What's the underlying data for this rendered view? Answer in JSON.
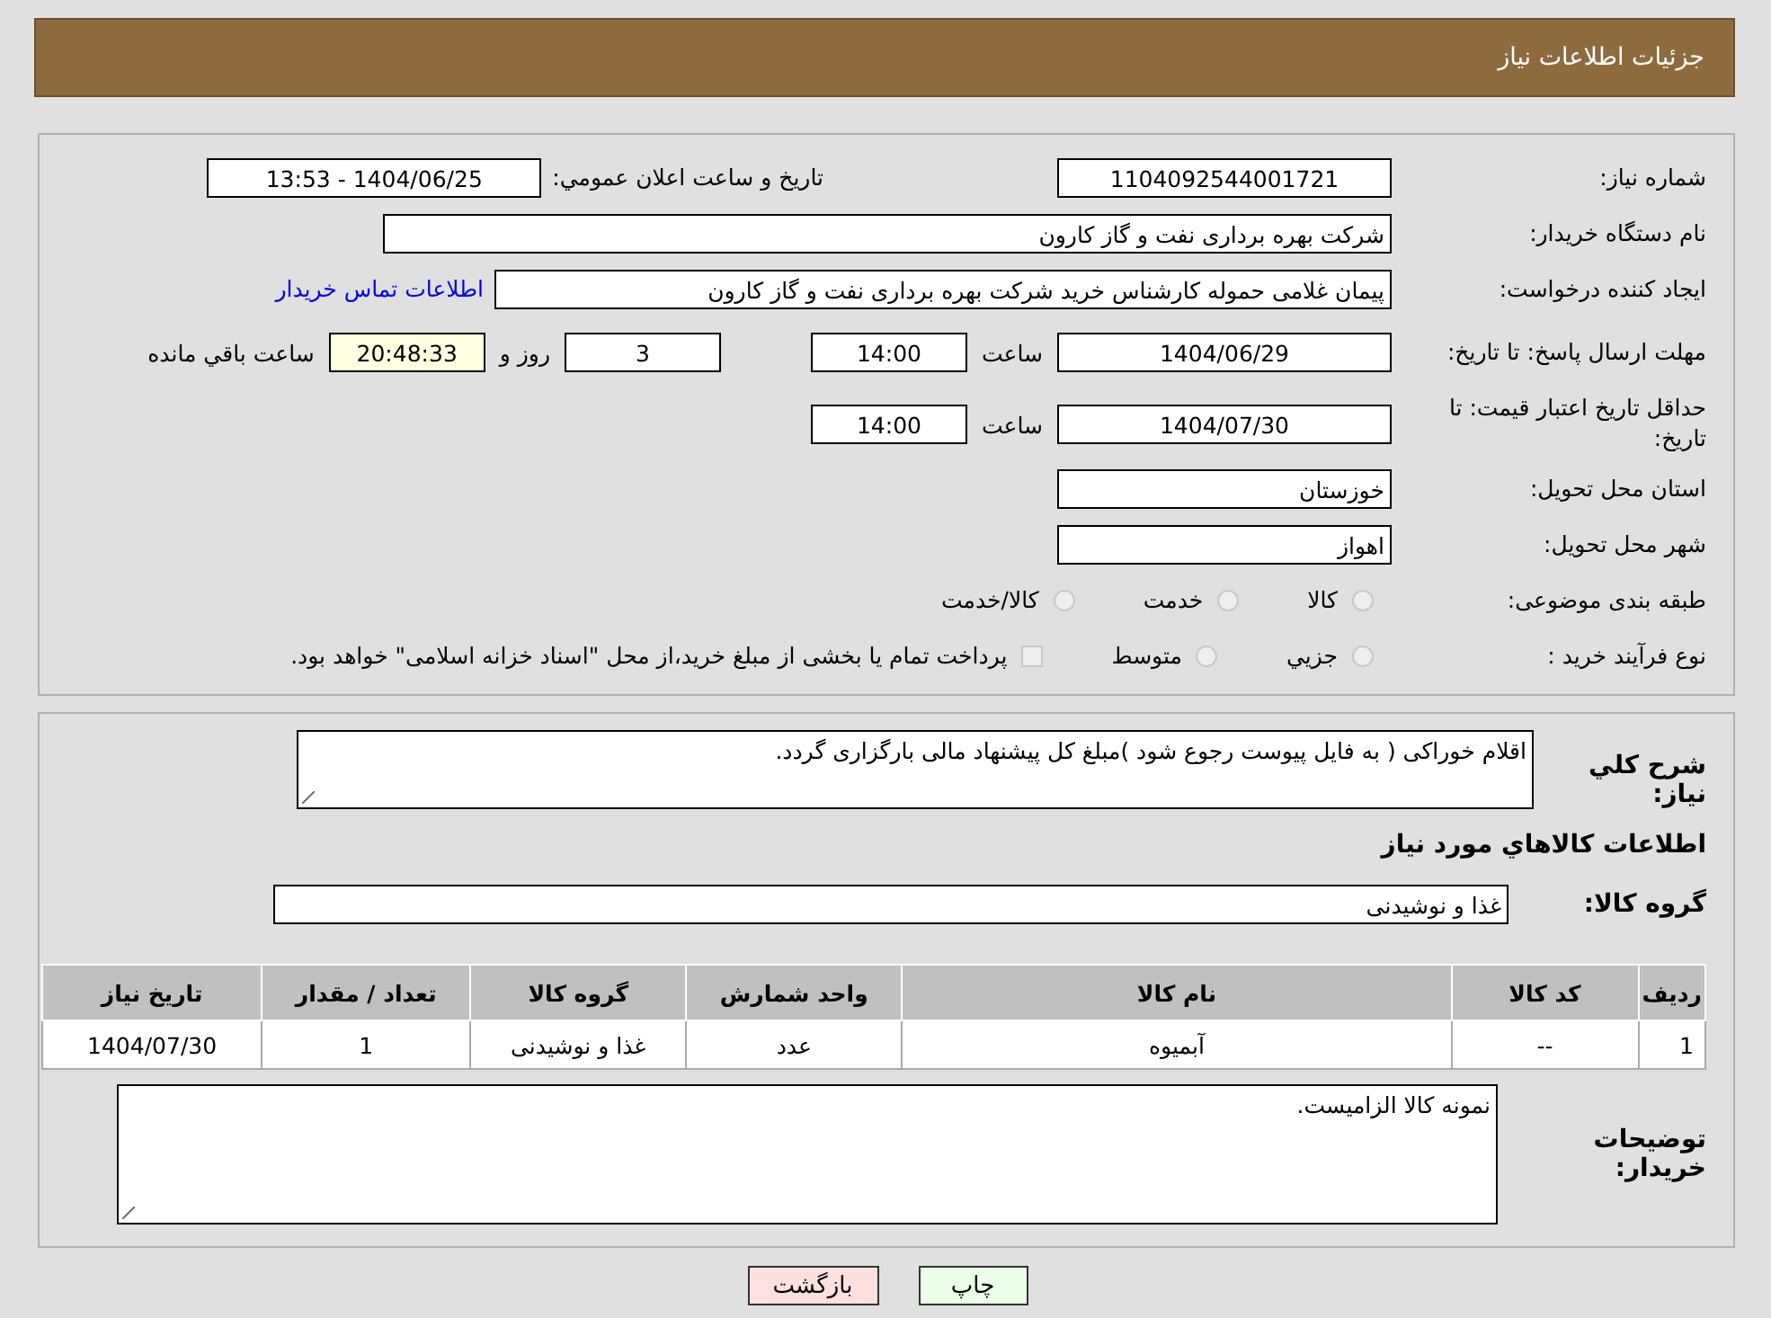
{
  "header": {
    "title": "جزئیات اطلاعات نیاز"
  },
  "need_number": {
    "label": "شماره نیاز:",
    "value": "1104092544001721"
  },
  "announce": {
    "label": "تاریخ و ساعت اعلان عمومي:",
    "value": "1404/06/25 - 13:53"
  },
  "buyer_org": {
    "label": "نام دستگاه خريدار:",
    "value": "شرکت بهره برداری نفت و گاز کارون"
  },
  "requester": {
    "label": "ايجاد کننده درخواست:",
    "value": "پیمان غلامی حموله کارشناس خرید شرکت بهره برداری نفت و گاز کارون",
    "link": "اطلاعات تماس خریدار"
  },
  "response_deadline": {
    "label": "مهلت ارسال پاسخ: تا تاریخ:",
    "date": "1404/06/29",
    "time_label": "ساعت",
    "time": "14:00",
    "days": "3",
    "days_label": "روز و",
    "remaining": "20:48:33",
    "remaining_label": "ساعت باقي مانده"
  },
  "price_validity": {
    "label": "حداقل تاریخ اعتبار قیمت: تا تاریخ:",
    "date": "1404/07/30",
    "time_label": "ساعت",
    "time": "14:00"
  },
  "province": {
    "label": "استان محل تحويل:",
    "value": "خوزستان"
  },
  "city": {
    "label": "شهر محل تحويل:",
    "value": "اهواز"
  },
  "category": {
    "label": "طبقه بندی موضوعی:",
    "options": [
      {
        "label": "کالا",
        "selected": false
      },
      {
        "label": "خدمت",
        "selected": false
      },
      {
        "label": "کالا/خدمت",
        "selected": false
      }
    ]
  },
  "purchase_type": {
    "label": "نوع فرآیند خرید :",
    "options": [
      {
        "label": "جزيي",
        "selected": false
      },
      {
        "label": "متوسط",
        "selected": false
      }
    ],
    "payment_note": {
      "text": "پرداخت تمام یا بخشی از مبلغ خرید،از محل \"اسناد خزانه اسلامی\" خواهد بود.",
      "checked": false
    }
  },
  "description": {
    "label": "شرح کلي نياز:",
    "value": "اقلام خوراکی ( به فایل پیوست رجوع شود )مبلغ کل پیشنهاد مالی بارگزاری گردد."
  },
  "goods_heading": "اطلاعات کالاهاي مورد نياز",
  "goods_group": {
    "label": "گروه کالا:",
    "value": "غذا و نوشیدنی"
  },
  "table": {
    "columns": [
      "ردیف",
      "کد کالا",
      "نام کالا",
      "واحد شمارش",
      "گروه کالا",
      "تعداد / مقدار",
      "تاریخ نیاز"
    ],
    "rows": [
      [
        "1",
        "--",
        "آبمیوه",
        "عدد",
        "غذا و نوشیدنی",
        "1",
        "1404/07/30"
      ]
    ]
  },
  "buyer_notes": {
    "label": "توضیحات خریدار:",
    "value": "نمونه کالا الزامیست."
  },
  "buttons": [
    {
      "label": "چاپ",
      "kind": "print"
    },
    {
      "label": "بازگشت",
      "kind": "back"
    }
  ]
}
